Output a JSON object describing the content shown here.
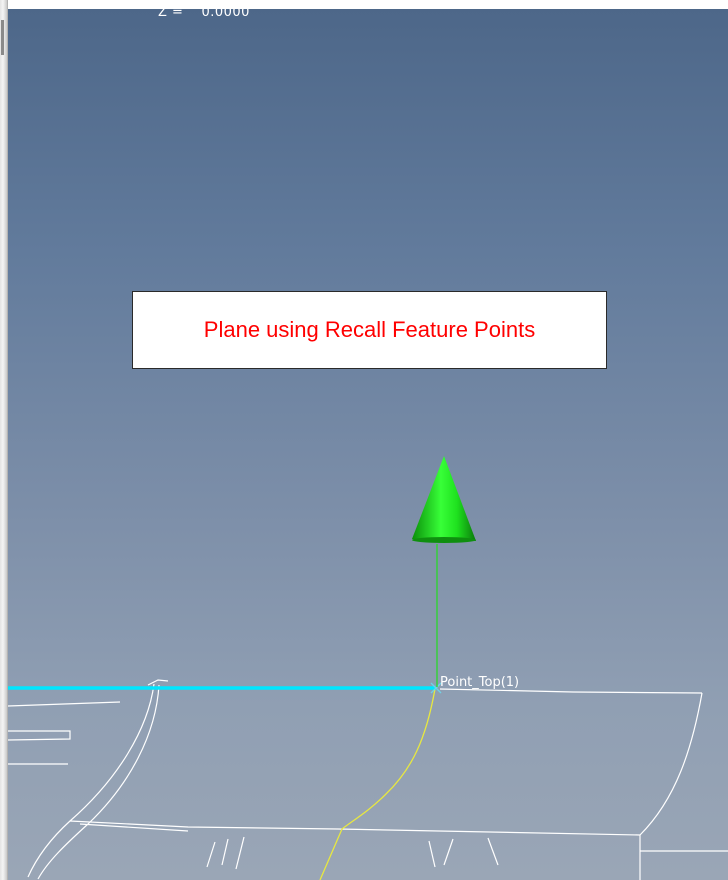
{
  "viewport": {
    "coord_readout": {
      "label": "Z =",
      "value": "0.0000"
    },
    "callout_text": "Plane using Recall Feature Points",
    "point_label": "Point_Top(1)",
    "normal_arrow": {
      "icon": "normal-arrow-icon",
      "color": "#00cc00"
    },
    "plane_edge_color": "#00e6ff",
    "curve_color": "#e8e840",
    "wireframe_color": "#ffffff"
  }
}
